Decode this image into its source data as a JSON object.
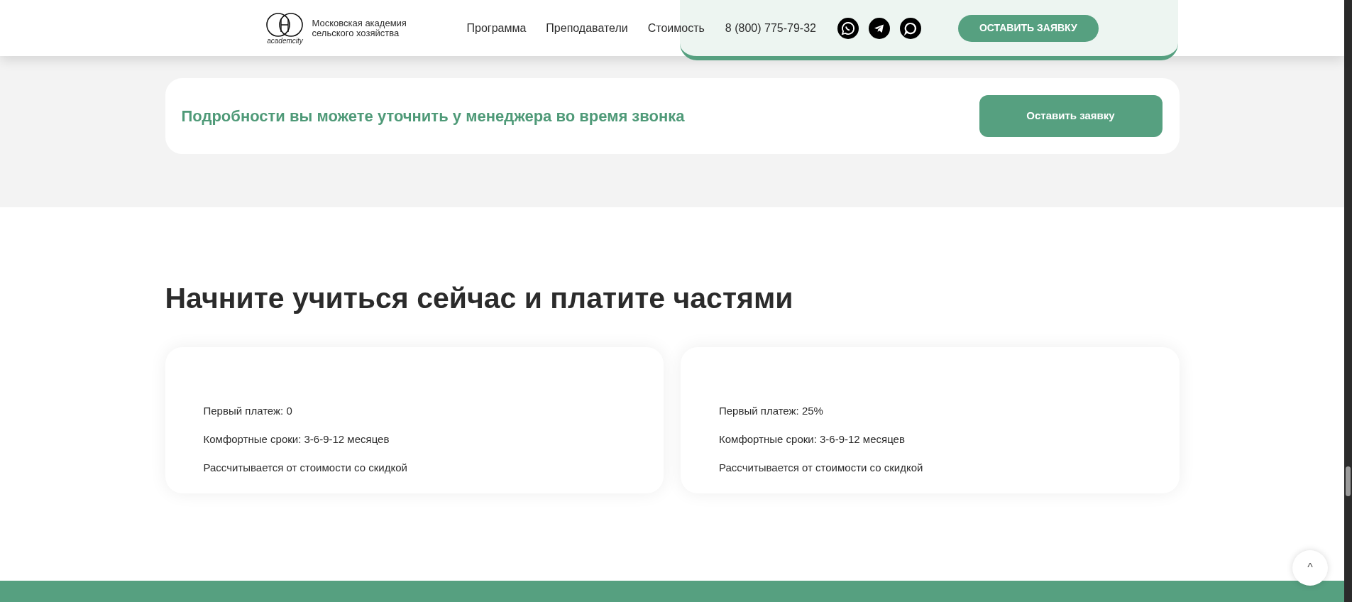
{
  "header": {
    "logo_caption": "academcity",
    "logo_text": "Московская академия сельского хозяйства",
    "nav": [
      "Программа",
      "Преподаватели",
      "Стоимость"
    ],
    "phone": "8 (800) 775-79-32",
    "cta": "ОСТАВИТЬ ЗАЯВКУ"
  },
  "banner": {
    "text": "Подробности вы можете уточнить у менеджера во время звонка",
    "button": "Оставить заявку"
  },
  "installments": {
    "title": "Начните учиться сейчас и платите частями",
    "cards": [
      {
        "lines": [
          "Первый платеж: 0",
          "Комфортные сроки: 3-6-9-12 месяцев",
          "Рассчитывается от стоимости со скидкой"
        ]
      },
      {
        "lines": [
          "Первый платеж: 25%",
          "Комфортные сроки: 3-6-9-12 месяцев",
          "Рассчитывается от стоимости со скидкой"
        ]
      }
    ]
  },
  "scroll_top": {
    "label": "^"
  }
}
